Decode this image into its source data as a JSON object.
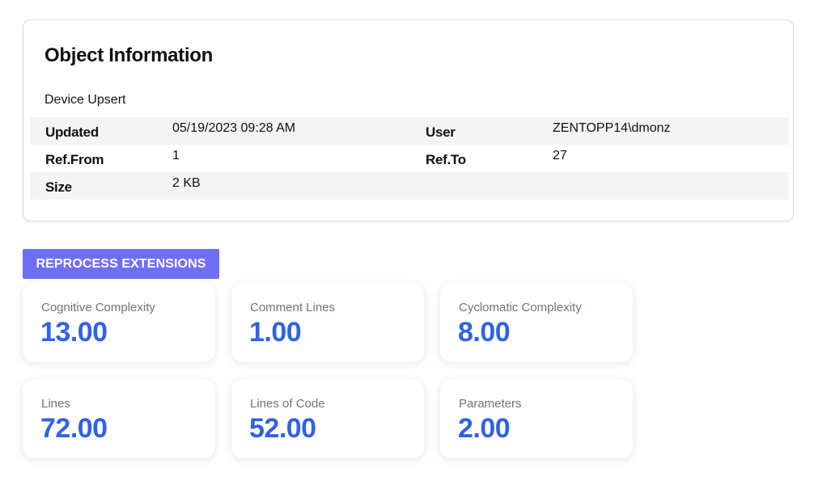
{
  "object_info": {
    "title": "Object Information",
    "subtitle": "Device Upsert",
    "rows": [
      {
        "label1": "Updated",
        "value1": "05/19/2023 09:28 AM",
        "label2": "User",
        "value2": "ZENTOPP14\\dmonz"
      },
      {
        "label1": "Ref.From",
        "value1": "1",
        "label2": "Ref.To",
        "value2": "27"
      },
      {
        "label1": "Size",
        "value1": "2 KB",
        "label2": "",
        "value2": ""
      }
    ]
  },
  "actions": {
    "reprocess_label": "REPROCESS EXTENSIONS"
  },
  "metrics": [
    {
      "label": "Cognitive Complexity",
      "value": "13.00"
    },
    {
      "label": "Comment Lines",
      "value": "1.00"
    },
    {
      "label": "Cyclomatic Complexity",
      "value": "8.00"
    },
    {
      "label": "Lines",
      "value": "72.00"
    },
    {
      "label": "Lines of Code",
      "value": "52.00"
    },
    {
      "label": "Parameters",
      "value": "2.00"
    }
  ],
  "colors": {
    "accent_button": "#6f6ff5",
    "metric_value": "#2f62e6",
    "metric_label": "#6b7280",
    "row_shade": "#f4f4f4"
  }
}
